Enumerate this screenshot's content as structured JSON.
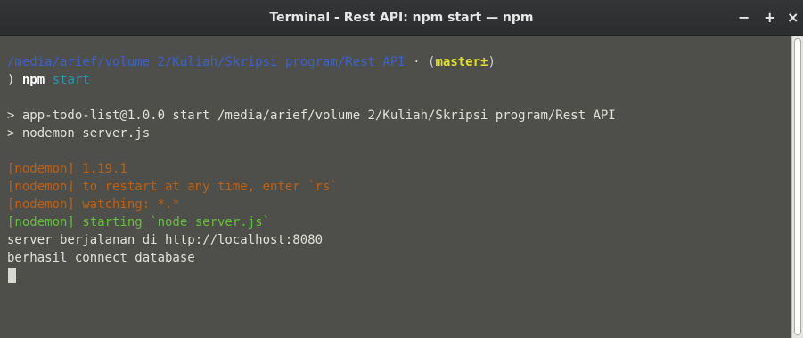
{
  "window": {
    "title": "Terminal - Rest API: npm start — npm",
    "minimize_label": "−",
    "maximize_label": "+",
    "close_label": "×"
  },
  "terminal": {
    "prompt_path": "/media/arief/volume 2/Kuliah/Skripsi program/Rest API",
    "prompt_separator": " · ",
    "prompt_branch_open": "(",
    "prompt_branch": "master±",
    "prompt_branch_close": ")",
    "prompt_symbol": ") ",
    "command": "npm",
    "command_arg": " start",
    "output_line1": "> app-todo-list@1.0.0 start /media/arief/volume 2/Kuliah/Skripsi program/Rest API",
    "output_line2": "> nodemon server.js",
    "nodemon_version": "[nodemon] 1.19.1",
    "nodemon_restart": "[nodemon] to restart at any time, enter `rs`",
    "nodemon_watching": "[nodemon] watching: *.*",
    "nodemon_starting": "[nodemon] starting `node server.js`",
    "server_line": "server berjalanan di http://localhost:8080",
    "db_line": "berhasil connect database"
  },
  "colors": {
    "background": "#4e4e4a",
    "path": "#3a61d3",
    "branch": "#e3de28",
    "arg": "#2a95b8",
    "nodemon_orange": "#c05f10",
    "nodemon_green": "#62c13a",
    "text": "#e0e0da"
  }
}
